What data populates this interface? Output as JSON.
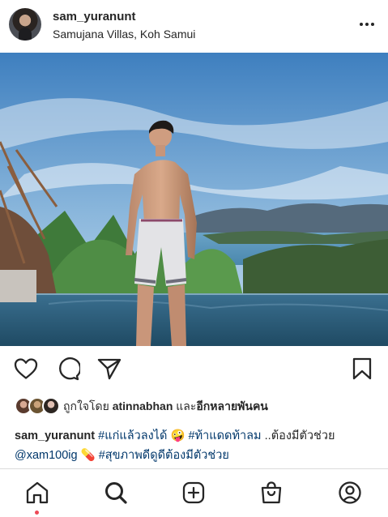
{
  "post": {
    "username": "sam_yuranunt",
    "location": "Samujana Villas, Koh Samui"
  },
  "likes": {
    "prefix": "ถูกใจโดย ",
    "user": "atinnabhan",
    "middle": " และ",
    "others": "อีกหลายพันคน"
  },
  "caption": {
    "username": "sam_yuranunt",
    "tag1": "#แก่แล้วลงได้",
    "emoji1": "🤪",
    "tag2": "#ท้าแดดท้าลม",
    "text1": " ..ต้องมีตัวช่วย",
    "mention": "@xam100ig",
    "emoji2": "💊",
    "tag3": "#สุขภาพดีดูดีต้องมีตัวช่วย"
  },
  "icons": {
    "more": "more-dots-icon",
    "like": "heart-icon",
    "comment": "comment-icon",
    "share": "paper-plane-icon",
    "save": "bookmark-icon",
    "nav": [
      "home-icon",
      "search-icon",
      "add-post-icon",
      "shop-bag-icon",
      "profile-icon"
    ]
  },
  "colors": {
    "text": "#262626",
    "link": "#00376b",
    "notification_dot": "#ed4956",
    "divider": "#dbdbdb"
  }
}
